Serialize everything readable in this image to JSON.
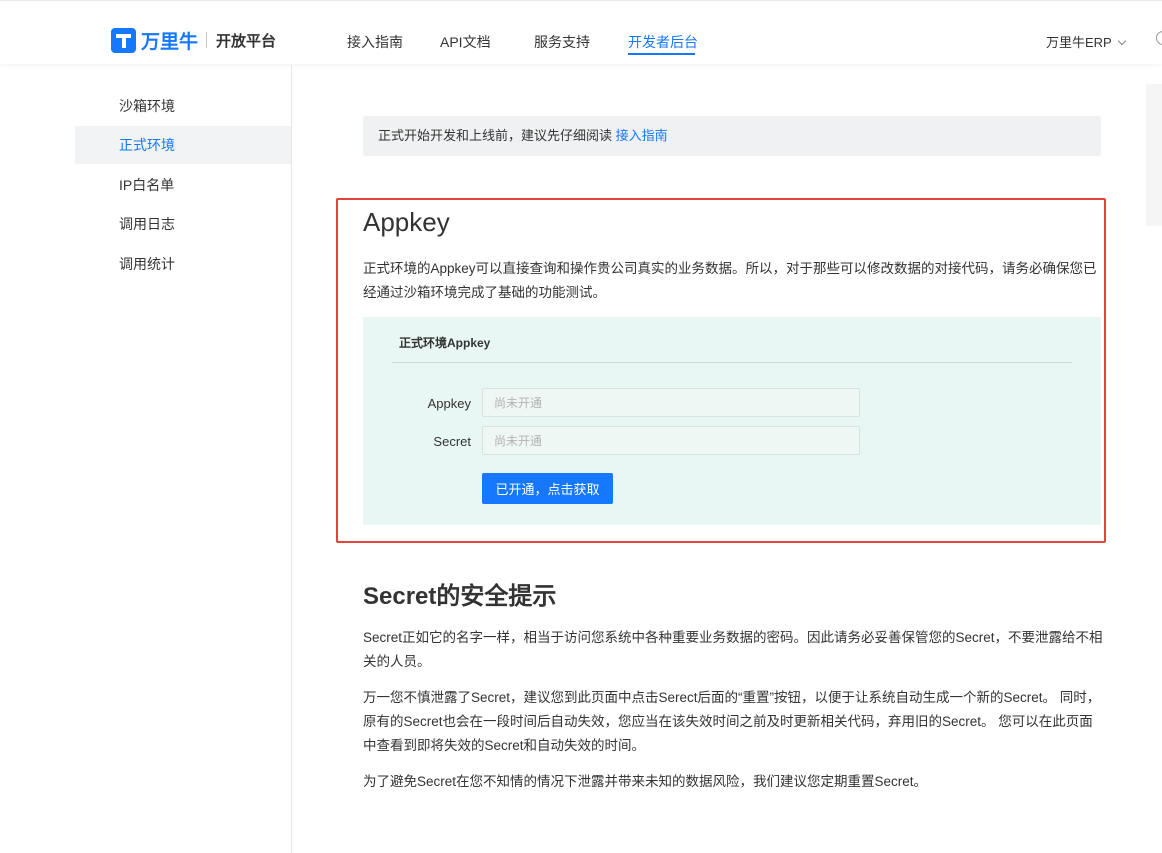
{
  "header": {
    "logo_icon": "wanliniu-logo-icon",
    "brand": "万里牛",
    "subtitle": "开放平台",
    "nav": [
      {
        "label": "接入指南",
        "active": false
      },
      {
        "label": "API文档",
        "active": false
      },
      {
        "label": "服务支持",
        "active": false
      },
      {
        "label": "开发者后台",
        "active": true
      }
    ],
    "account_label": "万里牛ERP",
    "account_icon": "chevron-down-icon",
    "accent_color": "#1677ff"
  },
  "sidebar": {
    "items": [
      {
        "label": "沙箱环境",
        "active": false
      },
      {
        "label": "正式环境",
        "active": true
      },
      {
        "label": "IP白名单",
        "active": false
      },
      {
        "label": "调用日志",
        "active": false
      },
      {
        "label": "调用统计",
        "active": false
      }
    ]
  },
  "notice": {
    "text": "正式开始开发和上线前，建议先仔细阅读 ",
    "link": "接入指南"
  },
  "appkey_section": {
    "title": "Appkey",
    "intro": "正式环境的Appkey可以直接查询和操作贵公司真实的业务数据。所以，对于那些可以修改数据的对接代码，请务必确保您已经通过沙箱环境完成了基础的功能测试。",
    "panel": {
      "title": "正式环境Appkey",
      "appkey_label": "Appkey",
      "appkey_placeholder": "尚未开通",
      "secret_label": "Secret",
      "secret_placeholder": "尚未开通",
      "button_label": "已开通，点击获取",
      "background_color": "#e8f7f3"
    },
    "highlight_color": "#e0443a"
  },
  "secret_section": {
    "title": "Secret的安全提示",
    "paragraphs": [
      "Secret正如它的名字一样，相当于访问您系统中各种重要业务数据的密码。因此请务必妥善保管您的Secret，不要泄露给不相关的人员。",
      "万一您不慎泄露了Secret，建议您到此页面中点击Serect后面的“重置”按钮，以便于让系统自动生成一个新的Secret。 同时，原有的Secret也会在一段时间后自动失效，您应当在该失效时间之前及时更新相关代码，弃用旧的Secret。 您可以在此页面中查看到即将失效的Secret和自动失效的时间。",
      "为了避免Secret在您不知情的情况下泄露并带来未知的数据风险，我们建议您定期重置Secret。"
    ]
  }
}
